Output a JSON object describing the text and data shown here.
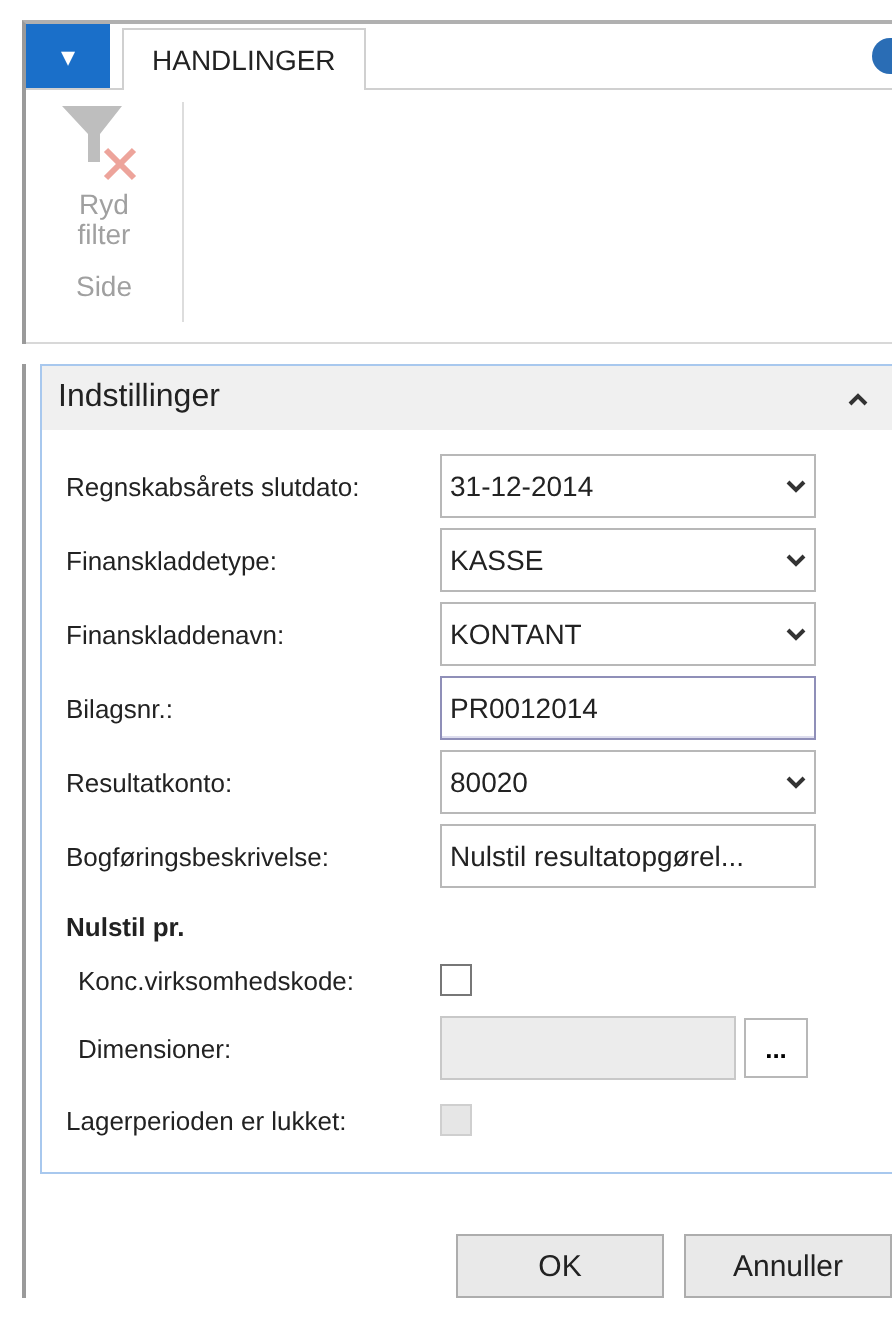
{
  "ribbon": {
    "menu_button": {
      "label": "▾"
    },
    "tabs": [
      {
        "label": "HANDLINGER",
        "selected": true
      }
    ],
    "actions": [
      {
        "label": "Ryd filter",
        "disabled": true
      }
    ],
    "group_label": "Side"
  },
  "panel": {
    "title": "Indstillinger",
    "expanded": true,
    "rows": [
      {
        "kind": "dropdown",
        "label": "Regnskabsårets slutdato:",
        "value": "31-12-2014"
      },
      {
        "kind": "dropdown",
        "label": "Finanskladdetype:",
        "value": "KASSE"
      },
      {
        "kind": "dropdown",
        "label": "Finanskladdenavn:",
        "value": "KONTANT"
      },
      {
        "kind": "text",
        "label": "Bilagsnr.:",
        "value": "PR0012014",
        "focused": true
      },
      {
        "kind": "dropdown",
        "label": "Resultatkonto:",
        "value": "80020"
      },
      {
        "kind": "text",
        "label": "Bogføringsbeskrivelse:",
        "value": "Nulstil resultatopgørel...",
        "focused": false
      },
      {
        "kind": "group",
        "label": "Nulstil pr.",
        "children": [
          {
            "kind": "checkbox",
            "label": "Konc.virksomhedskode:",
            "checked": false,
            "disabled": false
          },
          {
            "kind": "lookup",
            "label": "Dimensioner:",
            "button": "..."
          }
        ]
      },
      {
        "kind": "checkbox",
        "label": "Lagerperioden er lukket:",
        "checked": false,
        "disabled": true
      }
    ]
  },
  "buttons": [
    {
      "label": "OK"
    },
    {
      "label": "Annuller"
    }
  ]
}
